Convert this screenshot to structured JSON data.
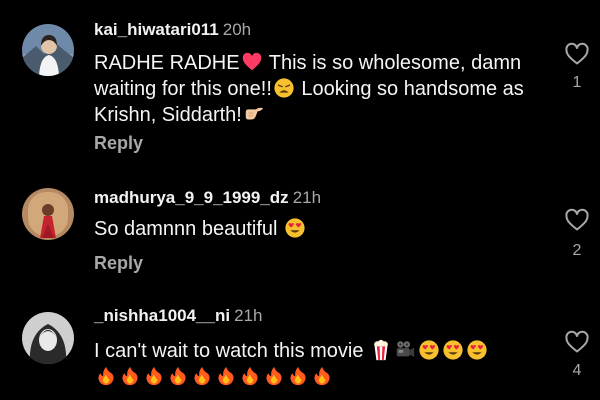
{
  "comments": [
    {
      "username": "kai_hiwatari011",
      "time": "20h",
      "text_parts": [
        "RADHE RADHE",
        " This is so wholesome, damn waiting for this one!!",
        " Looking so handsome as Krishn, Siddarth!"
      ],
      "reply_label": "Reply",
      "likes": "1"
    },
    {
      "username": "madhurya_9_9_1999_dz",
      "time": "21h",
      "text_parts": [
        "So damnnn beautiful "
      ],
      "reply_label": "Reply",
      "likes": "2"
    },
    {
      "username": "_nishha1004__ni",
      "time": "21h",
      "text_parts": [
        "I can't wait to watch this movie "
      ],
      "likes": "4"
    }
  ],
  "icons": {
    "like": "heart-outline-icon",
    "emoji_heart": "red-heart-emoji",
    "emoji_weary": "weary-face-emoji",
    "emoji_point": "backhand-pointing-right-emoji",
    "emoji_heart_eyes": "heart-eyes-emoji",
    "emoji_popcorn": "popcorn-emoji",
    "emoji_camera": "movie-camera-emoji",
    "emoji_fire": "fire-emoji"
  },
  "colors": {
    "background": "#000000",
    "text": "#f5f5f5",
    "secondary": "#a8a8a8",
    "emoji_heart": "#ff3b63"
  }
}
